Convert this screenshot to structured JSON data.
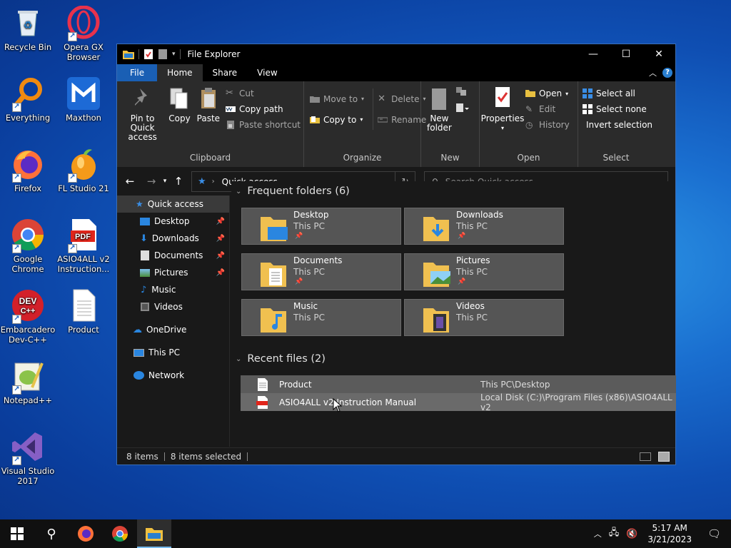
{
  "desktop": {
    "icons": [
      {
        "label": "Recycle Bin"
      },
      {
        "label": "Opera GX Browser"
      },
      {
        "label": "Everything"
      },
      {
        "label": "Maxthon"
      },
      {
        "label": "Firefox"
      },
      {
        "label": "FL Studio 21"
      },
      {
        "label": "Google Chrome"
      },
      {
        "label": "ASIO4ALL v2 Instruction..."
      },
      {
        "label": "Embarcadero Dev-C++"
      },
      {
        "label": "Product"
      },
      {
        "label": "Notepad++"
      },
      {
        "label": "Visual Studio 2017"
      }
    ]
  },
  "window": {
    "title": "File Explorer",
    "tabs": {
      "file": "File",
      "home": "Home",
      "share": "Share",
      "view": "View"
    },
    "ribbon": {
      "clipboard": {
        "label": "Clipboard",
        "pin": "Pin to Quick access",
        "copy": "Copy",
        "paste": "Paste",
        "cut": "Cut",
        "copy_path": "Copy path",
        "paste_shortcut": "Paste shortcut"
      },
      "organize": {
        "label": "Organize",
        "move_to": "Move to",
        "copy_to": "Copy to",
        "delete": "Delete",
        "rename": "Rename"
      },
      "new": {
        "label": "New",
        "new_folder": "New folder"
      },
      "open": {
        "label": "Open",
        "properties": "Properties",
        "open": "Open",
        "edit": "Edit",
        "history": "History"
      },
      "select": {
        "label": "Select",
        "select_all": "Select all",
        "select_none": "Select none",
        "invert": "Invert selection"
      }
    },
    "address": {
      "path": "Quick access"
    },
    "search": {
      "placeholder": "Search Quick access"
    },
    "nav": {
      "quick_access": "Quick access",
      "pinned": [
        {
          "label": "Desktop"
        },
        {
          "label": "Downloads"
        },
        {
          "label": "Documents"
        },
        {
          "label": "Pictures"
        }
      ],
      "music": "Music",
      "videos": "Videos",
      "onedrive": "OneDrive",
      "thispc": "This PC",
      "network": "Network"
    },
    "frequent": {
      "header": "Frequent folders (6)",
      "items": [
        {
          "name": "Desktop",
          "loc": "This PC"
        },
        {
          "name": "Downloads",
          "loc": "This PC"
        },
        {
          "name": "Documents",
          "loc": "This PC"
        },
        {
          "name": "Pictures",
          "loc": "This PC"
        },
        {
          "name": "Music",
          "loc": "This PC"
        },
        {
          "name": "Videos",
          "loc": "This PC"
        }
      ]
    },
    "recent": {
      "header": "Recent files (2)",
      "items": [
        {
          "name": "Product",
          "path": "This PC\\Desktop"
        },
        {
          "name": "ASIO4ALL v2 Instruction Manual",
          "path": "Local Disk (C:)\\Program Files (x86)\\ASIO4ALL v2"
        }
      ]
    },
    "status": {
      "count": "8 items",
      "selected": "8 items selected"
    }
  },
  "taskbar": {
    "time": "5:17 AM",
    "date": "3/21/2023"
  }
}
